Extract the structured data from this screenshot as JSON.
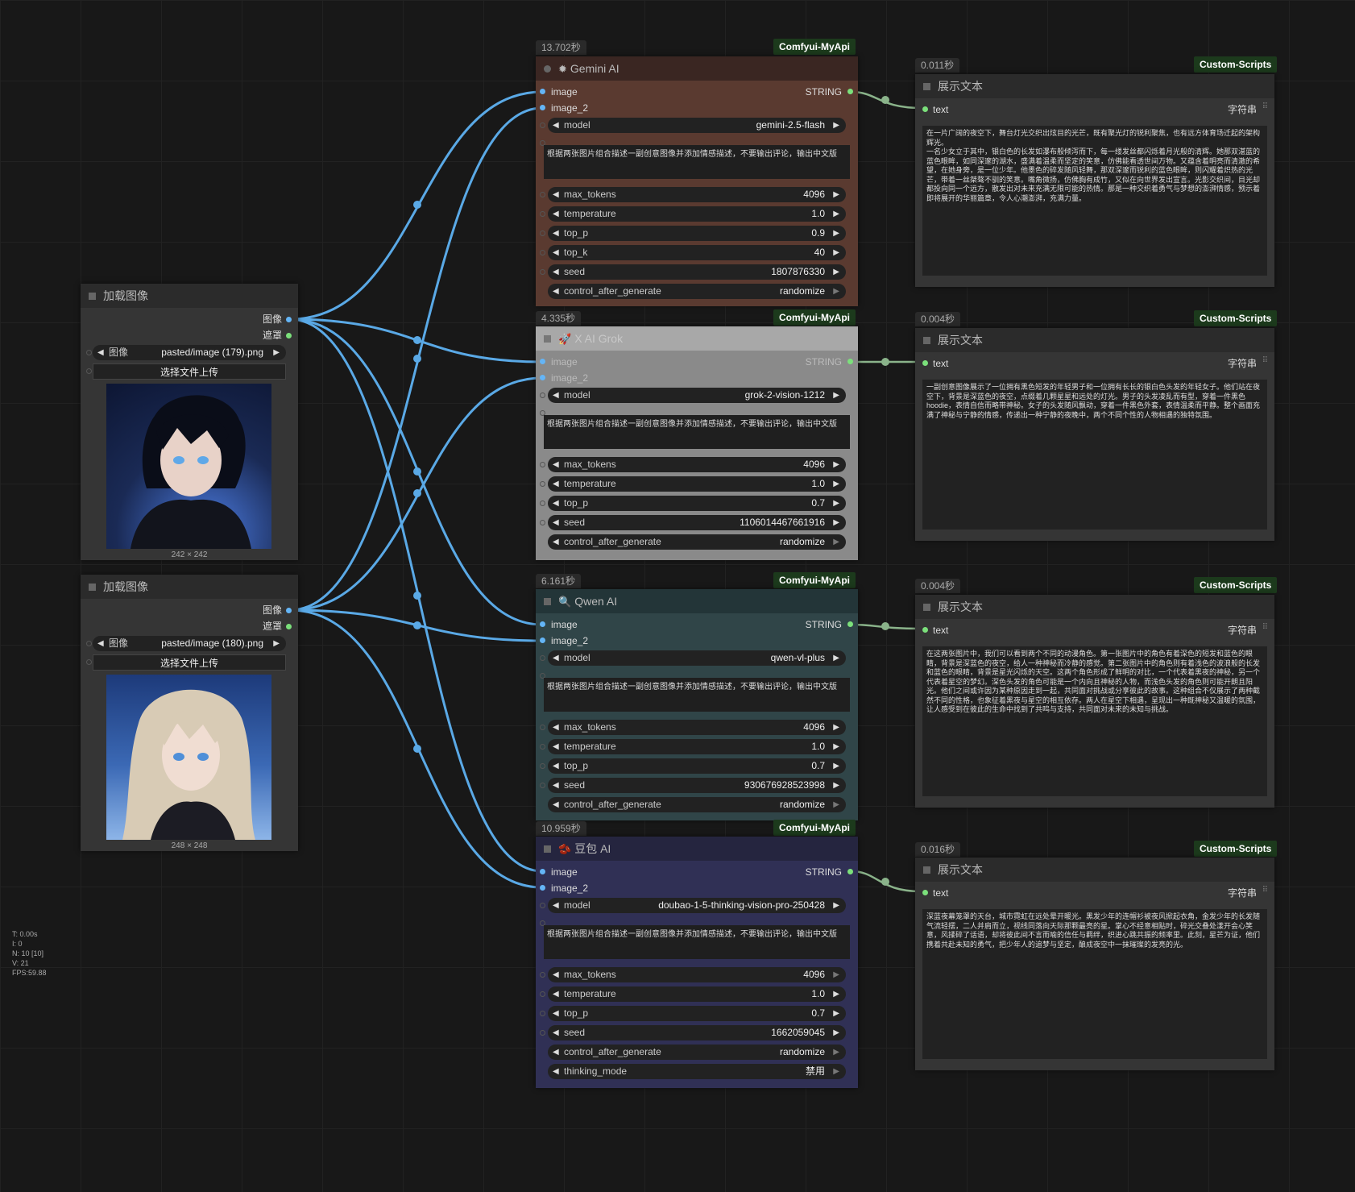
{
  "load_nodes": [
    {
      "title": "加载图像",
      "out_image": "图像",
      "out_mask": "遮罩",
      "widget_label": "图像",
      "file": "pasted/image (179).png",
      "upload": "选择文件上传",
      "size": "242 × 242"
    },
    {
      "title": "加载图像",
      "out_image": "图像",
      "out_mask": "遮罩",
      "widget_label": "图像",
      "file": "pasted/image (180).png",
      "upload": "选择文件上传",
      "size": "248 × 248"
    }
  ],
  "ai_nodes": [
    {
      "time": "13.702秒",
      "source": "Comfyui-MyApi",
      "title": "Gemini AI",
      "icon": "sparkle-icon",
      "color": "#5a3a30",
      "in1": "image",
      "in2": "image_2",
      "out": "STRING",
      "prompt": "根据两张图片组合描述一副创意图像并添加情感描述，不要输出评论，输出中文版",
      "widgets": [
        {
          "l": "model",
          "v": "gemini-2.5-flash"
        },
        {
          "l": "max_tokens",
          "v": "4096"
        },
        {
          "l": "temperature",
          "v": "1.0"
        },
        {
          "l": "top_p",
          "v": "0.9"
        },
        {
          "l": "top_k",
          "v": "40"
        },
        {
          "l": "seed",
          "v": "1807876330"
        },
        {
          "l": "control_after_generate",
          "v": "randomize"
        }
      ]
    },
    {
      "time": "4.335秒",
      "source": "Comfyui-MyApi",
      "title": "X AI Grok",
      "icon": "rocket-icon",
      "color": "#8a8a8a",
      "in1": "image",
      "in2": "image_2",
      "out": "STRING",
      "prompt": "根据两张图片组合描述一副创意图像并添加情感描述，不要输出评论，输出中文版",
      "widgets": [
        {
          "l": "model",
          "v": "grok-2-vision-1212"
        },
        {
          "l": "max_tokens",
          "v": "4096"
        },
        {
          "l": "temperature",
          "v": "1.0"
        },
        {
          "l": "top_p",
          "v": "0.7"
        },
        {
          "l": "seed",
          "v": "1106014467661916"
        },
        {
          "l": "control_after_generate",
          "v": "randomize"
        }
      ]
    },
    {
      "time": "6.161秒",
      "source": "Comfyui-MyApi",
      "title": "Qwen AI",
      "icon": "magnifier-icon",
      "color": "#304548",
      "in1": "image",
      "in2": "image_2",
      "out": "STRING",
      "prompt": "根据两张图片组合描述一副创意图像并添加情感描述，不要输出评论，输出中文版",
      "widgets": [
        {
          "l": "model",
          "v": "qwen-vl-plus"
        },
        {
          "l": "max_tokens",
          "v": "4096"
        },
        {
          "l": "temperature",
          "v": "1.0"
        },
        {
          "l": "top_p",
          "v": "0.7"
        },
        {
          "l": "seed",
          "v": "930676928523998"
        },
        {
          "l": "control_after_generate",
          "v": "randomize"
        }
      ]
    },
    {
      "time": "10.959秒",
      "source": "Comfyui-MyApi",
      "title": "豆包 AI",
      "icon": "bean-icon",
      "color": "#303055",
      "in1": "image",
      "in2": "image_2",
      "out": "STRING",
      "prompt": "根据两张图片组合描述一副创意图像并添加情感描述，不要输出评论，输出中文版",
      "widgets": [
        {
          "l": "model",
          "v": "doubao-1-5-thinking-vision-pro-250428"
        },
        {
          "l": "max_tokens",
          "v": "4096"
        },
        {
          "l": "temperature",
          "v": "1.0"
        },
        {
          "l": "top_p",
          "v": "0.7"
        },
        {
          "l": "seed",
          "v": "1662059045"
        },
        {
          "l": "control_after_generate",
          "v": "randomize"
        },
        {
          "l": "thinking_mode",
          "v": "禁用"
        }
      ]
    }
  ],
  "show_nodes": [
    {
      "time": "0.011秒",
      "source": "Custom-Scripts",
      "title": "展示文本",
      "in": "text",
      "type": "字符串",
      "text": "在一片广阔的夜空下，舞台灯光交织出炫目的光芒，既有聚光灯的锐利聚焦，也有远方体育场迁起的架构辉光。\n一名少女立于其中，银白色的长发如瀑布般倾泻而下，每一缕发丝都闪烁着月光般的清辉。她那双湛蓝的蓝色眼眸，如同深邃的湖水，盛满着温柔而坚定的笑意，仿佛能看透世间万物。又蕴含着明亮而清澈的希望，在她身旁，是一位少年。他墨色的碎发随风轻舞，那双深邃而锐利的蓝色眼眸，则闪耀着炽热的光芒，带着一丝桀骜不驯的笑意。嘴角微扬，仿佛胸有成竹，又似在向世界发出宣言。光影交织间，目光却都投向同一个远方，散发出对未来充满无限可能的热情。那是一种交织着勇气与梦想的澎湃情感，预示着即将展开的华丽篇章，令人心潮澎湃，充满力量。"
    },
    {
      "time": "0.004秒",
      "source": "Custom-Scripts",
      "title": "展示文本",
      "in": "text",
      "type": "字符串",
      "text": "一副创意图像展示了一位拥有黑色短发的年轻男子和一位拥有长长的银白色头发的年轻女子。他们站在夜空下，背景是深蓝色的夜空，点缀着几颗星星和远处的灯光。男子的头发凌乱而有型，穿着一件黑色hoodie，表情自信而略带神秘。女子的头发随风飘动，穿着一件黑色外套，表情温柔而平静。整个画面充满了神秘与宁静的情感，传递出一种宁静的夜晚中，两个不同个性的人物相遇的独特氛围。"
    },
    {
      "time": "0.004秒",
      "source": "Custom-Scripts",
      "title": "展示文本",
      "in": "text",
      "type": "字符串",
      "text": "在这两张图片中，我们可以看到两个不同的动漫角色。第一张图片中的角色有着深色的短发和蓝色的眼睛，背景是深蓝色的夜空，给人一种神秘而冷静的感觉。第二张图片中的角色则有着浅色的波浪般的长发和蓝色的眼睛，背景是星光闪烁的天空。这两个角色形成了鲜明的对比，一个代表着黑夜的神秘，另一个代表着星空的梦幻。深色头发的角色可能是一个内向且神秘的人物，而浅色头发的角色则可能开朗且阳光。他们之间或许因为某种原因走到一起，共同面对挑战或分享彼此的故事。这种组合不仅展示了两种截然不同的性格，也象征着黑夜与星空的相互依存。两人在星空下相遇，呈现出一种既神秘又温暖的氛围，让人感受到在彼此的生命中找到了共鸣与支持，共同面对未来的未知与挑战。"
    },
    {
      "time": "0.016秒",
      "source": "Custom-Scripts",
      "title": "展示文本",
      "in": "text",
      "type": "字符串",
      "text": "深蓝夜幕笼罩的天台，城市霓虹在远处晕开暖光。黑发少年的连帽衫被夜风掀起衣角，金发少年的长发随气流轻摆，二人并肩而立，视线同落向天际那颗最亮的星。掌心不经意相贴时，碎光交叠处漾开会心笑意，风揉碎了话语，却将彼此间不言而喻的信任与羁绊，织进心跳共振的频率里。此刻，星芒为证，他们携着共赴未知的勇气，把少年人的追梦与坚定，酿成夜空中一抹璀璨的发亮的光。"
    }
  ],
  "stats": [
    "T: 0.00s",
    "I: 0",
    "N: 10 [10]",
    "V: 21",
    "FPS:59.88"
  ],
  "colors": {
    "wire": "#5aa9e6",
    "string_wire": "#8ab38a",
    "title_bar": "#2a2a2a"
  }
}
